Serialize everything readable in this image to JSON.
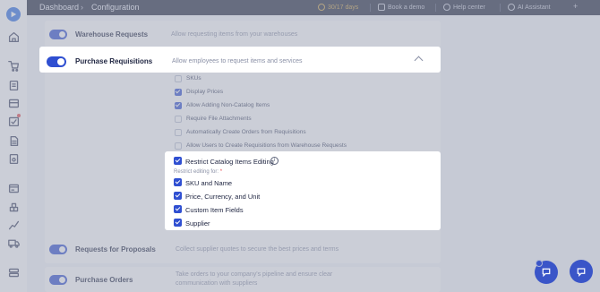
{
  "topbar": {
    "breadcrumb": [
      "Dashboard",
      "Configuration"
    ],
    "breadcrumb_sep": "›",
    "trial": "30/17 days",
    "book_demo": "Book a demo",
    "help": "Help center",
    "ai": "AI Assistant",
    "plus": "+"
  },
  "sections": {
    "warehouse": {
      "title": "Warehouse Requests",
      "desc": "Allow requesting items from your warehouses"
    },
    "purchase": {
      "title": "Purchase Requisitions",
      "desc": "Allow employees to request items and services"
    },
    "proposals": {
      "title": "Requests for Proposals",
      "desc": "Collect supplier quotes to secure the best prices and terms"
    },
    "orders": {
      "title": "Purchase Orders",
      "desc": "Take orders to your company's pipeline and ensure clear",
      "desc2": "communication with suppliers"
    }
  },
  "options": [
    {
      "label": "SKUs",
      "checked": false
    },
    {
      "label": "Display Prices",
      "checked": true
    },
    {
      "label": "Allow Adding Non-Catalog Items",
      "checked": true
    },
    {
      "label": "Require File Attachments",
      "checked": false
    },
    {
      "label": "Automatically Create Orders from Requisitions",
      "checked": false
    },
    {
      "label": "Allow Users to Create Requisitions from Warehouse Requests",
      "checked": false
    }
  ],
  "restrict": {
    "label": "Restrict Catalog Items Editing",
    "info_icon": "info-icon",
    "sublabel": "Restrict editing for:",
    "required_mark": "*",
    "items": [
      "SKU and Name",
      "Price, Currency, and Unit",
      "Custom Item Fields",
      "Supplier"
    ]
  },
  "colors": {
    "accent": "#2f4fd1",
    "topbar": "#23283f",
    "required": "#e5484d"
  }
}
